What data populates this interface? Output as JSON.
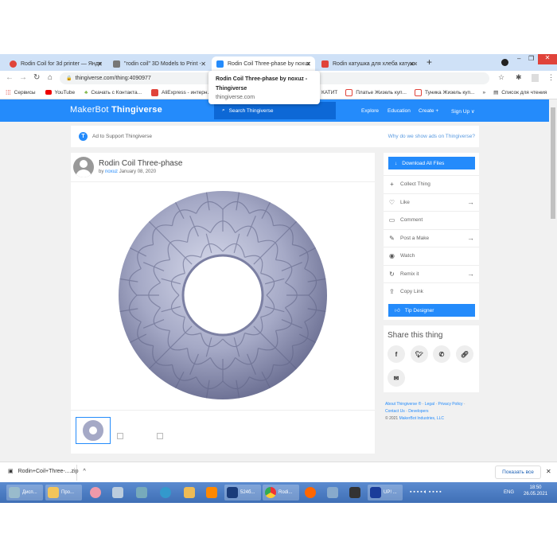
{
  "browser": {
    "tabs": [
      {
        "title": "Rodin Coil for 3d printer — Янде",
        "color": "#e0433a",
        "active": false
      },
      {
        "title": "\"rodin coil\" 3D Models to Print -",
        "color": "#5a5a5a",
        "active": false
      },
      {
        "title": "Rodin Coil Three-phase by noxuz",
        "color": "#248bfb",
        "active": true
      },
      {
        "title": "Rodin катушка для хлеба катушк",
        "color": "#e0433a",
        "active": false
      }
    ],
    "new_tab": "+",
    "url": "thingiverse.com/thing:4090977",
    "tooltip": {
      "title": "Rodin Coil Three-phase by noxuz - Thingiverse",
      "domain": "thingiverse.com"
    },
    "bookmarks": [
      "Сервисы",
      "YouTube",
      "Скачать с Контакта...",
      "AliExpress - интерн...",
      "КАТИТ",
      "Платье Жизель куп...",
      "Туника Жизель куп...",
      "»",
      "Список для чтения"
    ]
  },
  "site": {
    "logo_a": "MakerBot",
    "logo_b": "Thingiverse",
    "search_placeholder": "Search Thingiverse",
    "nav": [
      "Explore",
      "Education",
      "Create +",
      "Sign Up ∨"
    ],
    "ad_label": "Ad to Support Thingiverse",
    "ad_link": "Why do we show ads on Thingiverse?",
    "thing": {
      "title": "Rodin Coil Three-phase",
      "by": "by",
      "author": "noxuz",
      "date": "January 08, 2020"
    },
    "actions": {
      "download": "Download All Files",
      "rows": [
        {
          "label": "Collect Thing",
          "icon": "plus-icon",
          "arrow": false
        },
        {
          "label": "Like",
          "icon": "heart-icon",
          "arrow": true
        },
        {
          "label": "Comment",
          "icon": "comment-icon",
          "arrow": false
        },
        {
          "label": "Post a Make",
          "icon": "make-icon",
          "arrow": true
        },
        {
          "label": "Watch",
          "icon": "eye-icon",
          "arrow": false
        },
        {
          "label": "Remix it",
          "icon": "remix-icon",
          "arrow": true
        },
        {
          "label": "Copy Link",
          "icon": "share-icon",
          "arrow": false
        }
      ],
      "tip": "Tip Designer"
    },
    "share_title": "Share this thing",
    "footer": {
      "l1": [
        "About Thingiverse ®",
        "Legal",
        "Privacy Policy"
      ],
      "l2": [
        "Contact Us",
        "Developers"
      ],
      "copyright": "©  2021",
      "company": "MakerBot Industries, LLC"
    }
  },
  "download_bar": {
    "file": "Rodin+Coil+Three-....zip",
    "show_all": "Показать все"
  },
  "taskbar": {
    "items": [
      "Дисп...",
      "Про...",
      "524б...",
      "Rodi...",
      "UP! ..."
    ],
    "lang": "ENG",
    "time": "18:50",
    "date": "26.05.2021"
  },
  "colors": {
    "accent": "#248bfb",
    "search_bg": "#0d68d6"
  }
}
